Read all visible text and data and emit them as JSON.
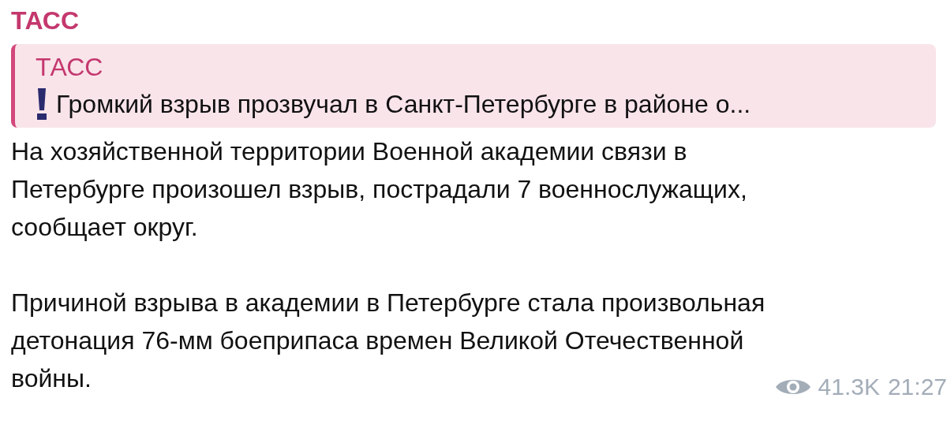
{
  "message": {
    "sender": "ТАСС",
    "reply": {
      "sender": "ТАСС",
      "text": "Громкий взрыв прозвучал в Санкт-Петербурге в районе о..."
    },
    "paragraphs": [
      "На хозяйственной территории Военной академии связи в\nПетербурге произошел взрыв, пострадали 7 военнослужащих,\nсообщает округ.",
      "Причиной взрыва в академии в Петербурге стала произвольная\nдетонация 76-мм боеприпаса времен Великой Отечественной\nвойны."
    ],
    "views": "41.3K",
    "time": "21:27"
  }
}
